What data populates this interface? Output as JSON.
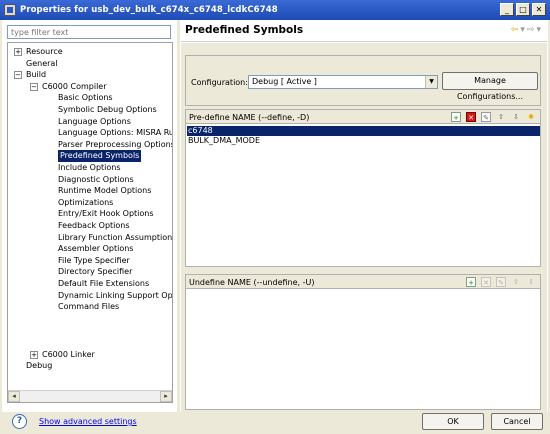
{
  "window": {
    "title": "Properties for usb_dev_bulk_c674x_c6748_lcdkC6748",
    "minimize": "_",
    "maximize": "□",
    "close": "✕"
  },
  "filter": {
    "placeholder": "type filter text"
  },
  "tree": {
    "resource": "Resource",
    "general": "General",
    "build": "Build",
    "compiler": "C6000 Compiler",
    "compiler_items": [
      "Basic Options",
      "Symbolic Debug Options",
      "Language Options",
      "Language Options: MISRA Rules",
      "Parser Preprocessing Options",
      "Predefined Symbols",
      "Include Options",
      "Diagnostic Options",
      "Runtime Model Options",
      "Optimizations",
      "Entry/Exit Hook Options",
      "Feedback Options",
      "Library Function Assumptions",
      "Assembler Options",
      "File Type Specifier",
      "Directory Specifier",
      "Default File Extensions",
      "Dynamic Linking Support Options",
      "Command Files"
    ],
    "linker": "C6000 Linker",
    "debug": "Debug",
    "expand": "+",
    "collapse": "−",
    "scroll_left": "◂",
    "scroll_right": "▸"
  },
  "page": {
    "title": "Predefined Symbols",
    "nav_back": "⇦",
    "nav_forward": "⇨",
    "nav_menu": "▾"
  },
  "configuration": {
    "label": "Configuration:",
    "value": "Debug  [ Active ]",
    "dropdown": "▼",
    "manage_label": "Manage Configurations..."
  },
  "predefine": {
    "header": "Pre-define NAME (--define, -D)",
    "entries": [
      "c6748",
      "BULK_DMA_MODE"
    ]
  },
  "undefine": {
    "header": "Undefine NAME (--undefine, -U)",
    "entries": []
  },
  "tool_glyphs": {
    "add": "+",
    "delete": "✕",
    "edit": "✎",
    "up": "⇧",
    "down": "⇩",
    "light": "✺"
  },
  "footer": {
    "help": "?",
    "advanced_link": "Show advanced settings",
    "ok": "OK",
    "cancel": "Cancel"
  }
}
